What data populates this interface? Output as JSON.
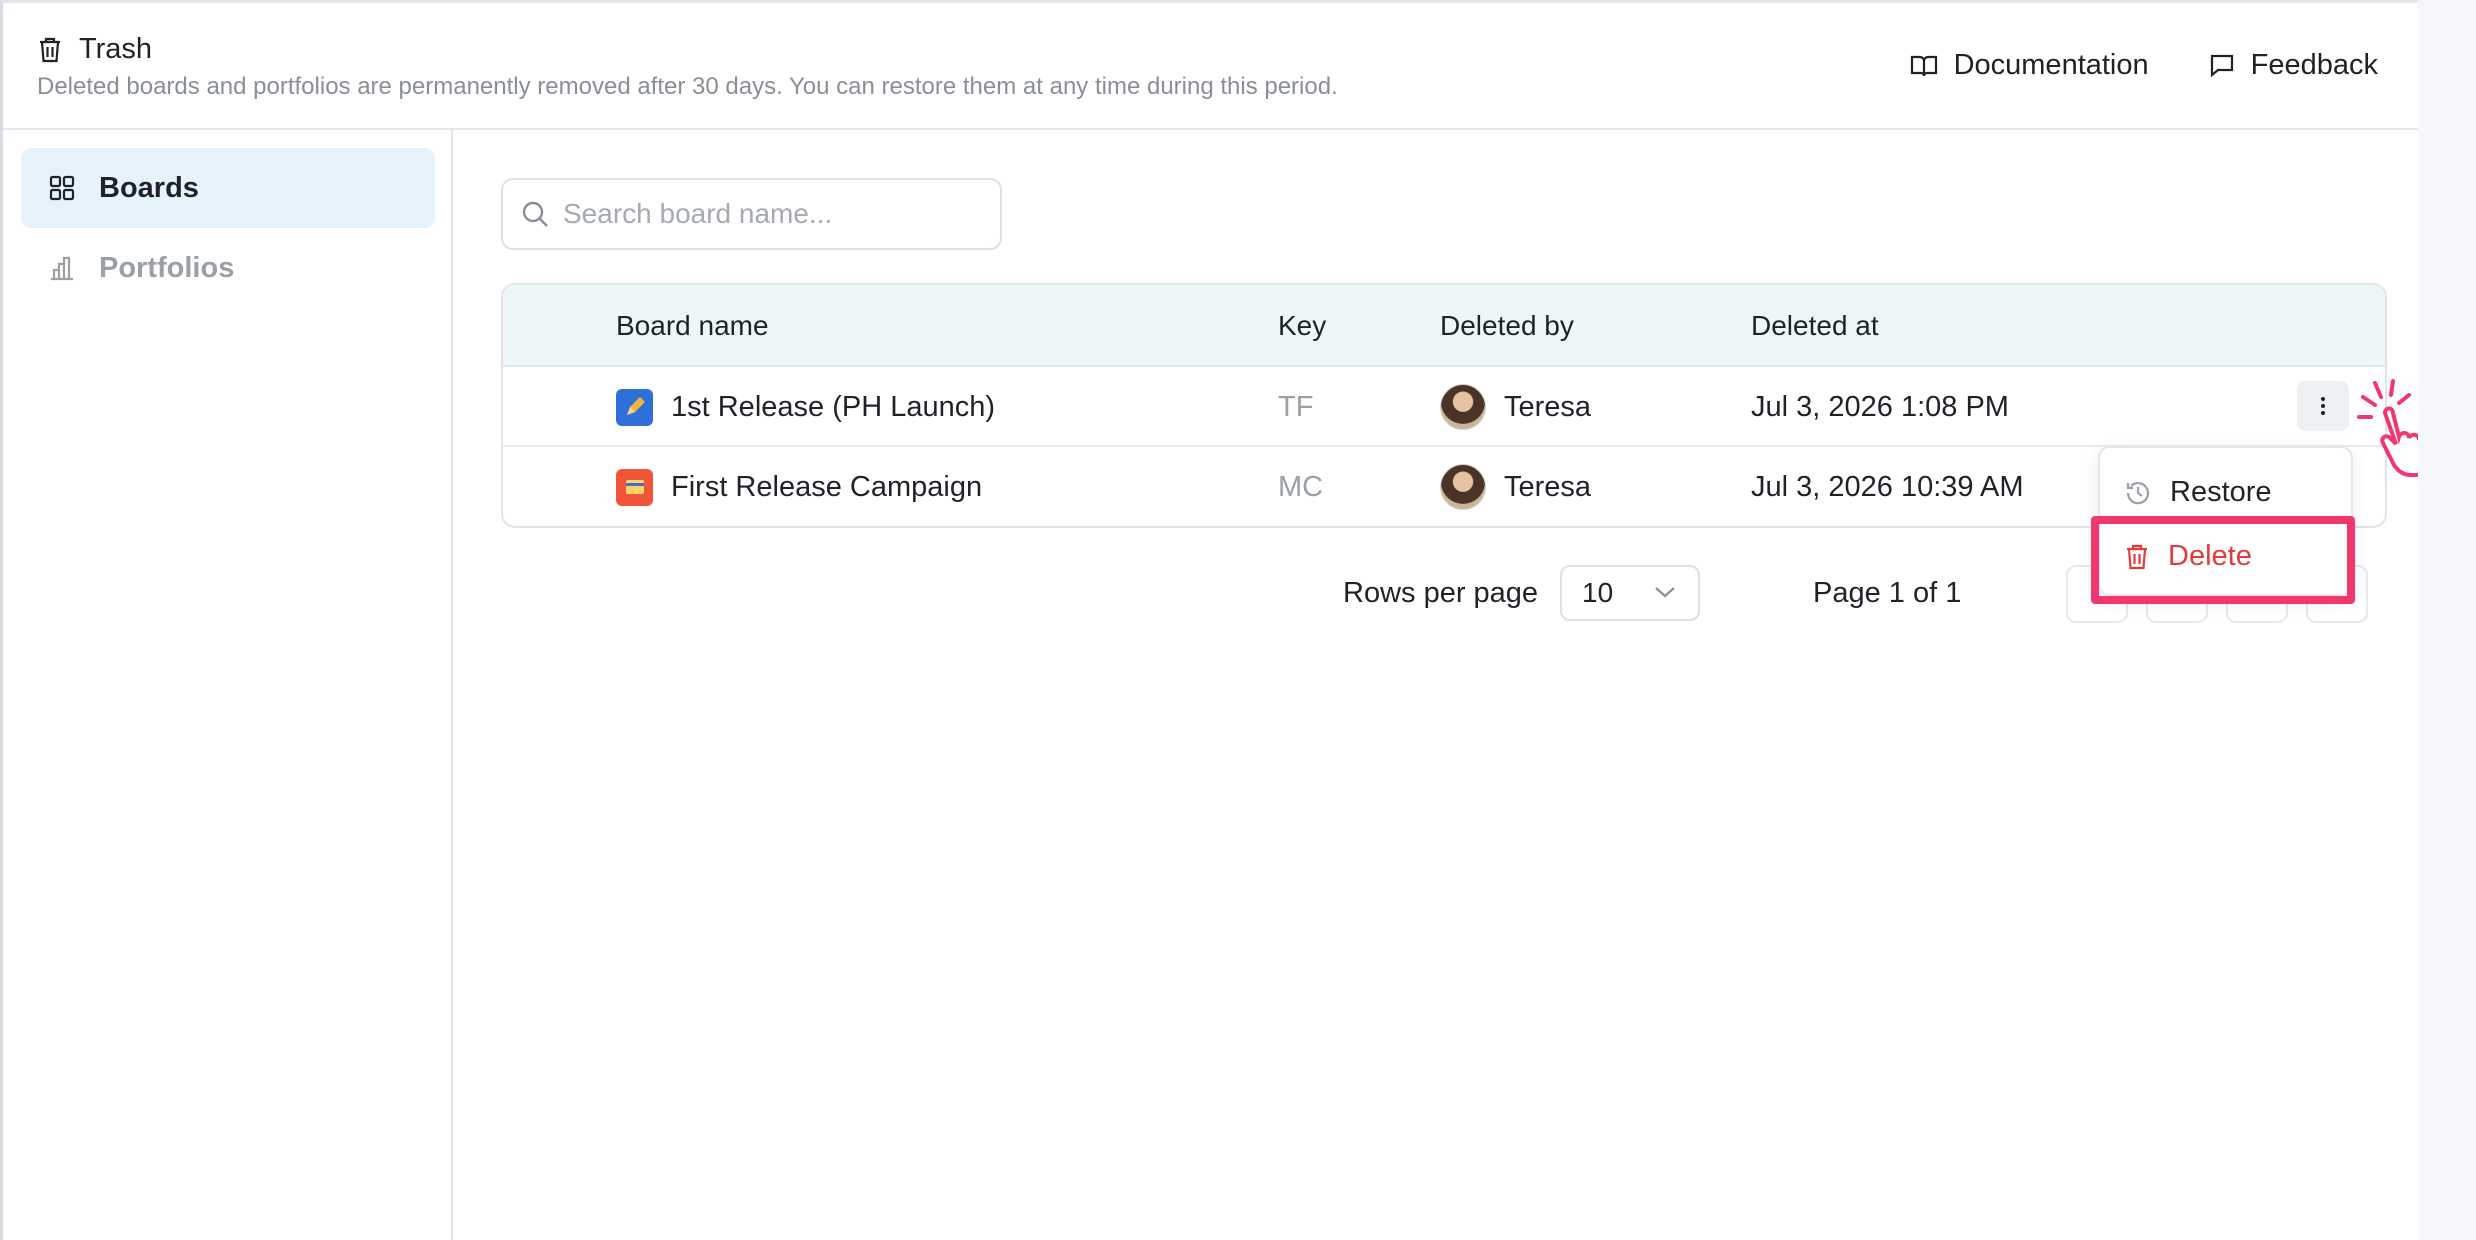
{
  "header": {
    "title": "Trash",
    "subtitle": "Deleted boards and portfolios are permanently removed after 30 days. You can restore them at any time during this period.",
    "links": [
      {
        "label": "Documentation",
        "icon": "book-icon"
      },
      {
        "label": "Feedback",
        "icon": "message-icon"
      }
    ]
  },
  "sidebar": {
    "items": [
      {
        "label": "Boards",
        "icon": "grid-icon",
        "active": true
      },
      {
        "label": "Portfolios",
        "icon": "bar-chart-icon",
        "active": false
      }
    ]
  },
  "search": {
    "placeholder": "Search board name...",
    "value": ""
  },
  "table": {
    "columns": [
      "Board name",
      "Key",
      "Deleted by",
      "Deleted at"
    ],
    "rows": [
      {
        "name": "1st Release (PH Launch)",
        "key": "TF",
        "deleted_by": "Teresa",
        "deleted_at": "Jul 3, 2026 1:08 PM",
        "icon_color": "#2f6fd8"
      },
      {
        "name": "First Release Campaign",
        "key": "MC",
        "deleted_by": "Teresa",
        "deleted_at": "Jul 3, 2026 10:39 AM",
        "icon_color": "#f0553a"
      }
    ]
  },
  "pagination": {
    "rows_per_page_label": "Rows per page",
    "rows_per_page_value": "10",
    "page_info": "Page 1 of 1"
  },
  "menu": {
    "restore_label": "Restore",
    "delete_label": "Delete"
  },
  "colors": {
    "accent_active_bg": "#e7f3fc",
    "delete_red": "#e03c3c",
    "highlight_pink": "#f0386f"
  }
}
